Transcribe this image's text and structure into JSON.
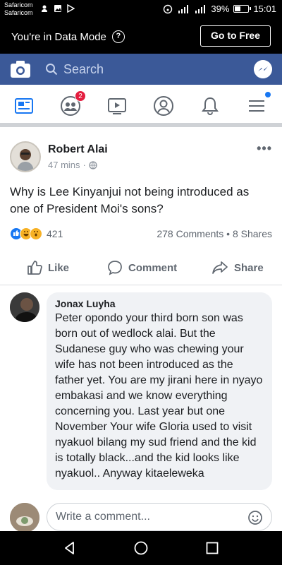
{
  "status_bar": {
    "carrier_1": "Safaricom",
    "carrier_2": "Safaricom",
    "battery": "39%",
    "time": "15:01"
  },
  "data_mode": {
    "text": "You're in Data Mode",
    "button": "Go to Free"
  },
  "fb_bar": {
    "search_placeholder": "Search"
  },
  "tabs": {
    "friend_requests_badge": "2"
  },
  "post": {
    "author": "Robert Alai",
    "time": "47 mins",
    "text": "Why is Lee Kinyanjui not being introduced as one of President Moi's sons?",
    "reactions_count": "421",
    "stats": "278 Comments • 8 Shares",
    "actions": {
      "like": "Like",
      "comment": "Comment",
      "share": "Share"
    }
  },
  "comment": {
    "author": "Jonax Luyha",
    "text": "Peter opondo your third born son was born out of wedlock alai.  But the Sudanese guy who was chewing your wife has not been introduced as the father yet.  You are my jirani here in nyayo embakasi and we know everything concerning you.  Last year but one November Your wife Gloria used to visit nyakuol bilang  my sud friend and the kid is totally black...and the kid looks like nyakuol.. Anyway kitaeleweka"
  },
  "compose": {
    "placeholder": "Write a comment..."
  },
  "colors": {
    "fb_blue": "#3b5998",
    "like_blue": "#1877f2",
    "badge_red": "#e41e3f"
  }
}
